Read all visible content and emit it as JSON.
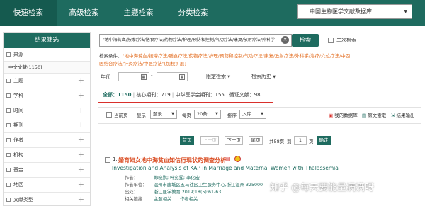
{
  "tabs": [
    {
      "label": "快速检索",
      "active": true
    },
    {
      "label": "高级检索",
      "active": false
    },
    {
      "label": "主题检索",
      "active": false
    },
    {
      "label": "分类检索",
      "active": false
    }
  ],
  "database_select": {
    "value": "中国生物医学文献数据库"
  },
  "sidebar": {
    "title": "结果筛选",
    "items": [
      {
        "label": "来源"
      },
      {
        "label": "主题"
      },
      {
        "label": "学科"
      },
      {
        "label": "时间"
      },
      {
        "label": "期刊"
      },
      {
        "label": "作者"
      },
      {
        "label": "机构"
      },
      {
        "label": "基金"
      },
      {
        "label": "地区"
      },
      {
        "label": "文献类型"
      }
    ],
    "source_sub": "中文文献(1150)"
  },
  "search": {
    "query": "\"地中海贫血/按摩疗法/膳食疗法/药物疗法/护理/预防和控制/气功疗法/康复/放射疗法/外科学",
    "button": "检索",
    "secondary_checkbox": "二次检索"
  },
  "conditions": {
    "label": "检索条件：",
    "text_line1": "\"地中海贫血/按摩疗法/膳食疗法/药物疗法/护理/预防和控制/气功疗法/康复/放射疗法/外科学/治疗/穴位疗法/中西",
    "text_line2": "医结合疗法/针灸疗法/中医疗法\"[加权扩展]"
  },
  "filters": {
    "year_label": "年代",
    "dash": "-",
    "limit_label": "限定检索",
    "history_label": "检索历史"
  },
  "stats": {
    "all_label": "全部：",
    "all_count": "1150",
    "core_label": "核心期刊：",
    "core_count": "719",
    "cma_label": "中华医学会期刊：",
    "cma_count": "155",
    "evidence_label": "循证文献：",
    "evidence_count": "98"
  },
  "toolbar": {
    "current_page": "当前页",
    "display_label": "显示",
    "display_value": "题录",
    "per_page_label": "每页",
    "per_page_value": "20条",
    "sort_label": "排序",
    "sort_value": "入库",
    "my_db": "我的数据库",
    "cite": "原文索取",
    "export": "结果输出"
  },
  "pagination": {
    "first": "首页",
    "prev": "上一页",
    "next": "下一页",
    "last": "尾页",
    "page_input": "1",
    "total": "共58页",
    "goto_prefix": "到",
    "page_suffix": "页",
    "confirm": "确定"
  },
  "result": {
    "index": "1.",
    "title": "婚育妇女地中海贫血知信行现状的调查分析",
    "en_title": "Investigation and Analysis of KAP in Marriage and Maternal Women with Thalassemia",
    "author_label": "作者：",
    "authors": "郑晓鹏; 叶宛冕; 李亿宏",
    "org_label": "作者单位：",
    "org": "温州市鹿城区五马社区卫生服务中心,浙江温州 325000",
    "source_label": "出处：",
    "source": "浙江医学教育 2019;18(5):61-63",
    "related_label": "相关链接",
    "related1": "主题相关",
    "related2": "作者相关"
  },
  "watermark": "知乎 @每天要能量满满呀",
  "colors": {
    "brand": "#1e6b5f",
    "highlight_border": "#d9302b",
    "orange_text": "#e36c1f"
  }
}
